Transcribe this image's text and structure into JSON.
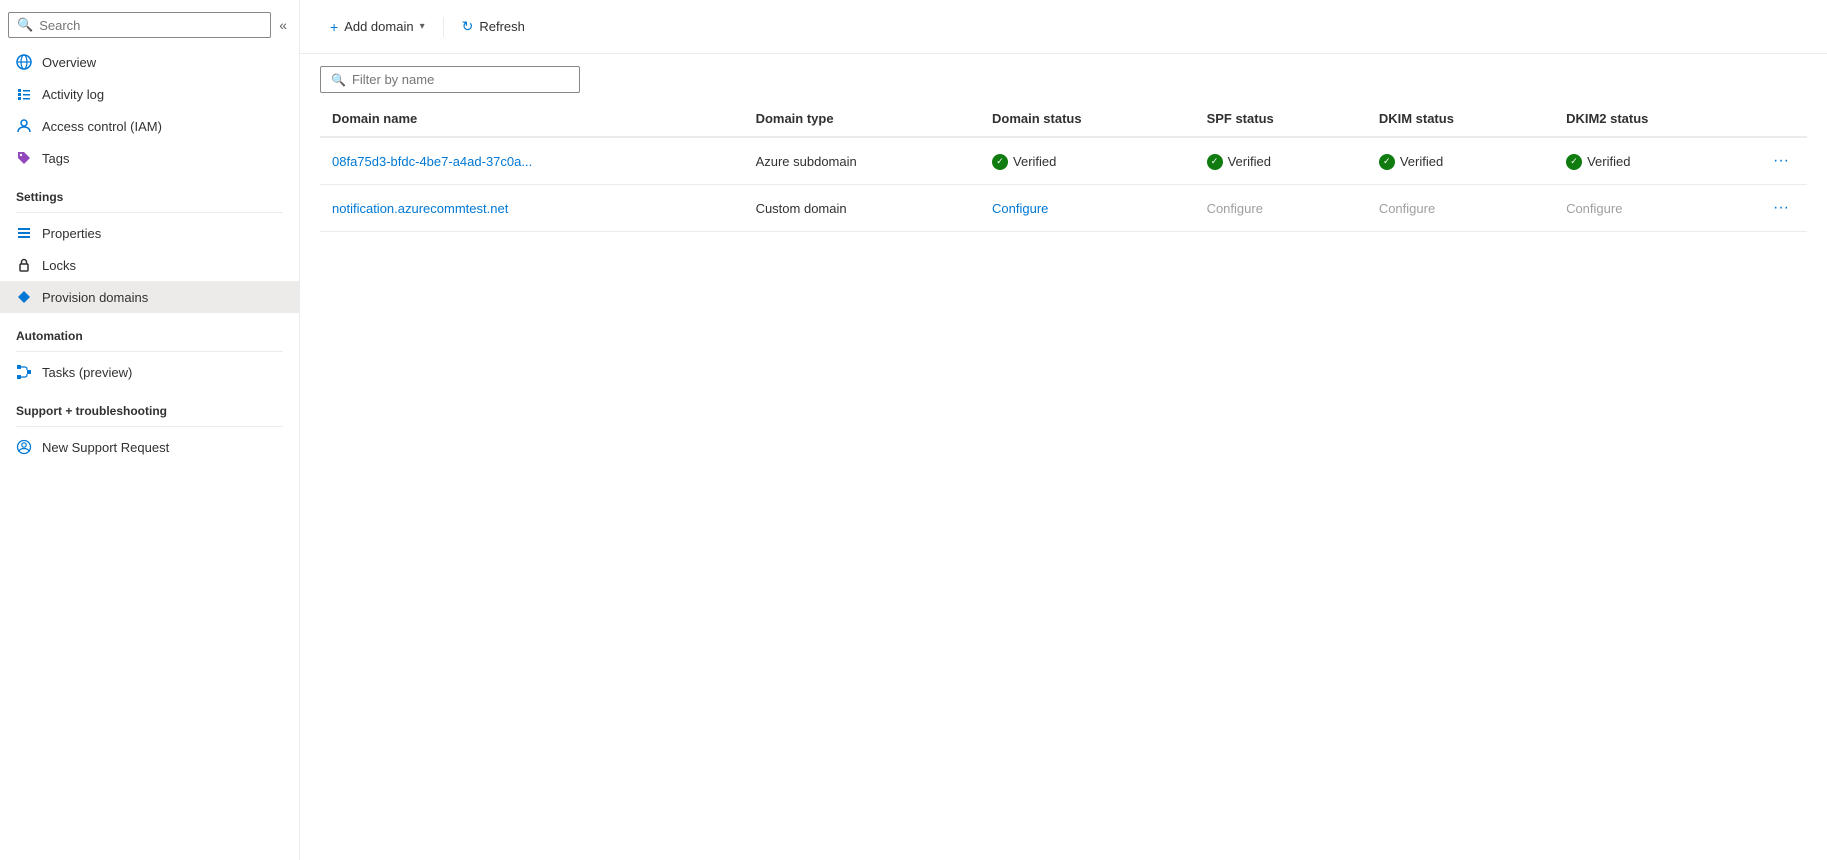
{
  "sidebar": {
    "search_placeholder": "Search",
    "nav_items": [
      {
        "id": "overview",
        "label": "Overview",
        "icon": "globe"
      },
      {
        "id": "activity-log",
        "label": "Activity log",
        "icon": "list"
      },
      {
        "id": "access-control",
        "label": "Access control (IAM)",
        "icon": "person"
      },
      {
        "id": "tags",
        "label": "Tags",
        "icon": "tag"
      }
    ],
    "sections": [
      {
        "title": "Settings",
        "items": [
          {
            "id": "properties",
            "label": "Properties",
            "icon": "bars"
          },
          {
            "id": "locks",
            "label": "Locks",
            "icon": "lock"
          },
          {
            "id": "provision-domains",
            "label": "Provision domains",
            "icon": "diamond",
            "active": true
          }
        ]
      },
      {
        "title": "Automation",
        "items": [
          {
            "id": "tasks",
            "label": "Tasks (preview)",
            "icon": "flow"
          }
        ]
      },
      {
        "title": "Support + troubleshooting",
        "items": [
          {
            "id": "support",
            "label": "New Support Request",
            "icon": "person-circle"
          }
        ]
      }
    ]
  },
  "toolbar": {
    "add_domain_label": "Add domain",
    "add_domain_dropdown": true,
    "refresh_label": "Refresh"
  },
  "filter": {
    "placeholder": "Filter by name"
  },
  "table": {
    "columns": [
      {
        "id": "domain-name",
        "label": "Domain name"
      },
      {
        "id": "domain-type",
        "label": "Domain type"
      },
      {
        "id": "domain-status",
        "label": "Domain status"
      },
      {
        "id": "spf-status",
        "label": "SPF status"
      },
      {
        "id": "dkim-status",
        "label": "DKIM status"
      },
      {
        "id": "dkim2-status",
        "label": "DKIM2 status"
      }
    ],
    "rows": [
      {
        "domain_name": "08fa75d3-bfdc-4be7-a4ad-37c0a...",
        "domain_type": "Azure subdomain",
        "domain_status": "Verified",
        "domain_status_type": "verified",
        "spf_status": "Verified",
        "spf_status_type": "verified",
        "dkim_status": "Verified",
        "dkim_status_type": "verified",
        "dkim2_status": "Verified",
        "dkim2_status_type": "verified"
      },
      {
        "domain_name": "notification.azurecommtest.net",
        "domain_type": "Custom domain",
        "domain_status": "Configure",
        "domain_status_type": "configure-link",
        "spf_status": "Configure",
        "spf_status_type": "configure-grey",
        "dkim_status": "Configure",
        "dkim_status_type": "configure-grey",
        "dkim2_status": "Configure",
        "dkim2_status_type": "configure-grey"
      }
    ]
  }
}
